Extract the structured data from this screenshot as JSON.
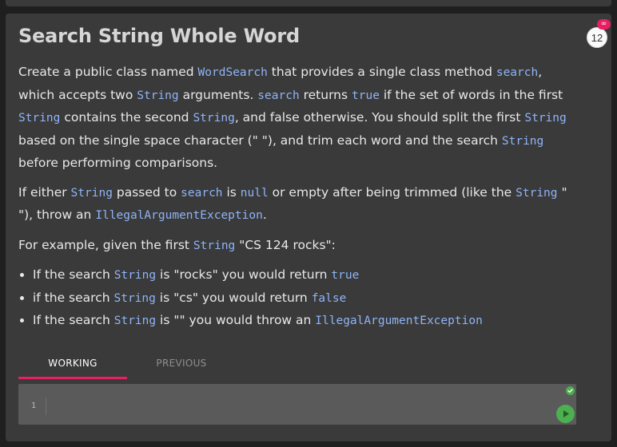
{
  "problem": {
    "title": "Search String Whole Word",
    "attempt_count": "12",
    "infinity_badge": "∞",
    "paragraph1": {
      "t1": "Create a public class named ",
      "c1": "WordSearch",
      "t2": " that provides a single class method ",
      "c2": "search",
      "t3": ", which accepts two ",
      "c3": "String",
      "t4": " arguments. ",
      "c4": "search",
      "t5": " returns ",
      "c5": "true",
      "t6": " if the set of words in the first ",
      "c6": "String",
      "t7": " contains the second ",
      "c7": "String",
      "t8": ", and false otherwise. You should split the first ",
      "c8": "String",
      "t9": " based on the single space character (\" \"), and trim each word and the search ",
      "c9": "String",
      "t10": " before performing comparisons."
    },
    "paragraph2": {
      "t1": "If either ",
      "c1": "String",
      "t2": " passed to ",
      "c2": "search",
      "t3": " is ",
      "c3": "null",
      "t4": " or empty after being trimmed (like the ",
      "c4": "String",
      "t5": " \" \"), throw an ",
      "c5": "IllegalArgumentException",
      "t6": "."
    },
    "paragraph3": {
      "t1": "For example, given the first ",
      "c1": "String",
      "t2": " \"CS 124 rocks\":"
    },
    "examples": [
      {
        "t1": "If the search ",
        "c1": "String",
        "t2": " is \"rocks\" you would return ",
        "c2": "true"
      },
      {
        "t1": "if the search ",
        "c1": "String",
        "t2": " is \"cs\" you would return ",
        "c2": "false"
      },
      {
        "t1": "If the search ",
        "c1": "String",
        "t2": " is \"\" you would throw an ",
        "c2": "IllegalArgumentException"
      }
    ]
  },
  "tabs": {
    "working": "WORKING",
    "previous": "PREVIOUS"
  },
  "editor": {
    "line_number": "1",
    "content": ""
  },
  "colors": {
    "accent": "#e91e63",
    "success": "#4caf50",
    "code_text": "#8fb4f7"
  },
  "icons": {
    "status": "check-circle-icon",
    "run": "play-icon"
  }
}
